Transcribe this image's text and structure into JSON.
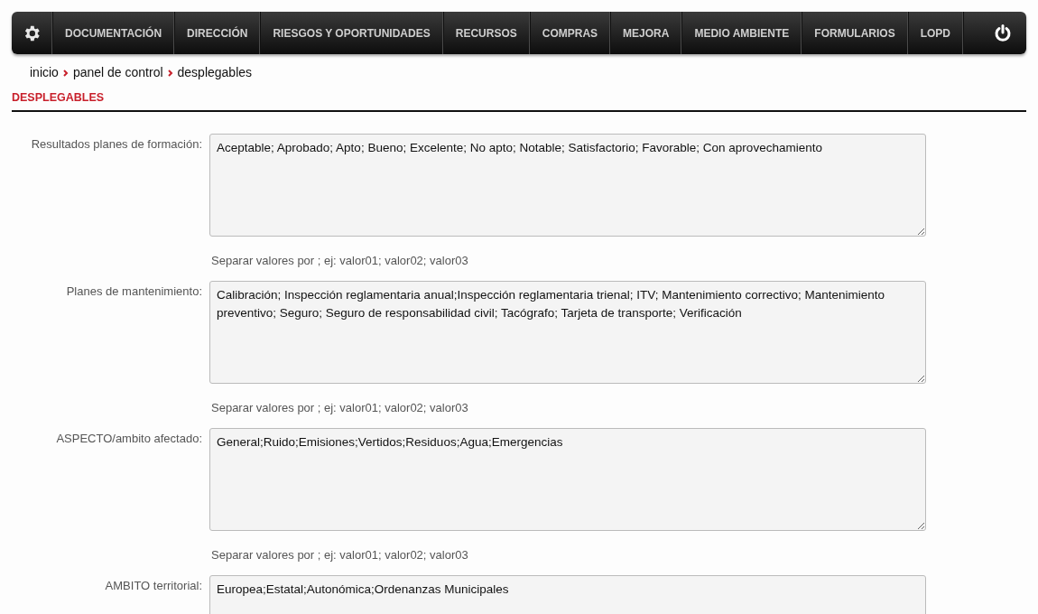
{
  "menu": [
    {
      "label": "DOCUMENTACIÓN"
    },
    {
      "label": "DIRECCIÓN"
    },
    {
      "label": "RIESGOS Y OPORTUNIDADES"
    },
    {
      "label": "RECURSOS"
    },
    {
      "label": "COMPRAS"
    },
    {
      "label": "MEJORA"
    },
    {
      "label": "MEDIO AMBIENTE"
    },
    {
      "label": "FORMULARIOS"
    },
    {
      "label": "LOPD"
    }
  ],
  "breadcrumb": [
    "inicio",
    "panel de control",
    "desplegables"
  ],
  "section_title": "DESPLEGABLES",
  "fields": [
    {
      "label": "Resultados planes de formación:",
      "value": "Aceptable; Aprobado; Apto; Bueno; Excelente; No apto; Notable; Satisfactorio; Favorable; Con aprovechamiento",
      "hint": "Separar valores por ; ej: valor01; valor02; valor03"
    },
    {
      "label": "Planes de mantenimiento:",
      "value": "Calibración; Inspección reglamentaria anual;Inspección reglamentaria trienal; ITV; Mantenimiento correctivo; Mantenimiento preventivo; Seguro; Seguro de responsabilidad civil; Tacógrafo; Tarjeta de transporte; Verificación",
      "hint": "Separar valores por ; ej: valor01; valor02; valor03"
    },
    {
      "label": "ASPECTO/ambito afectado:",
      "value": "General;Ruido;Emisiones;Vertidos;Residuos;Agua;Emergencias",
      "hint": "Separar valores por ; ej: valor01; valor02; valor03"
    },
    {
      "label": "AMBITO territorial:",
      "value": "Europea;Estatal;Autonómica;Ordenanzas Municipales"
    }
  ]
}
